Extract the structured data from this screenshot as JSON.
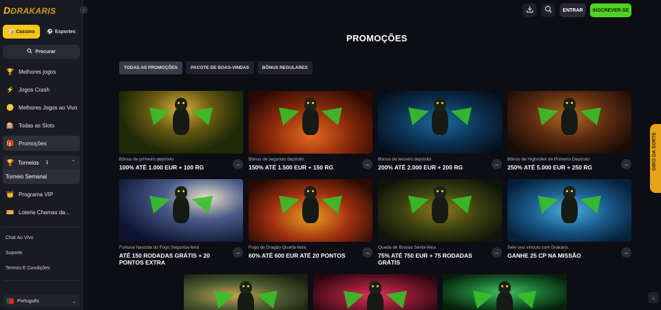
{
  "brand": {
    "logo_text": "DRAKARIS"
  },
  "sidebar": {
    "tabs": [
      {
        "label": "Cassino",
        "icon": "dice-icon",
        "active": true
      },
      {
        "label": "Esportes",
        "icon": "ball-icon",
        "active": false
      }
    ],
    "search_label": "Procurar",
    "items": [
      {
        "label": "Melhores jogos",
        "icon": "trophy-icon"
      },
      {
        "label": "Jogos Crash",
        "icon": "lightning-icon"
      },
      {
        "label": "Melhores Jogos ao Vivo",
        "icon": "chips-icon"
      },
      {
        "label": "Todas as Slots",
        "icon": "slot-icon"
      },
      {
        "label": "Promoções",
        "icon": "gift-icon",
        "active": true
      }
    ],
    "torneios": {
      "label": "Torneios",
      "count": "1",
      "sub_label": "Torneio Semanal"
    },
    "items2": [
      {
        "label": "Programa VIP",
        "icon": "crown-icon"
      },
      {
        "label": "Loteria Chamas da...",
        "icon": "ticket-icon"
      }
    ],
    "links": [
      "Chat Ao Vivo",
      "Suporte",
      "Termos E Condições"
    ],
    "language": "Português"
  },
  "header": {
    "entrar_label": "ENTRAR",
    "inscrever_label": "INSCREVER-SE"
  },
  "page": {
    "title": "PROMOÇÕES",
    "filters": [
      "TODAS AS PROMOÇÕES",
      "PACOTE DE BOAS-VINDAS",
      "BÔNUS REGULARES"
    ]
  },
  "promos": [
    {
      "subtitle": "Bônus de primeiro depósito",
      "title": "100% ATÉ 1.000 EUR + 100 RG"
    },
    {
      "subtitle": "Bônus de segundo depósito",
      "title": "150% ATÉ 1.500 EUR + 150 RG"
    },
    {
      "subtitle": "Bônus de terceiro depósito",
      "title": "200% ATÉ 2.000 EUR + 200 RG"
    },
    {
      "subtitle": "Bônus de Highroller de Primeiro Depósito",
      "title": "250% ATÉ 5.000 EUR + 250 RG"
    },
    {
      "subtitle": "Fortuna Nascida do Fogo Segunda-feira",
      "title": "ATÉ 150 RODADAS GRÁTIS + 20 PONTOS EXTRA"
    },
    {
      "subtitle": "Fogo de Dragão Quarta-feira",
      "title": "60% ATÉ 600 EUR ATÉ 20 PONTOS"
    },
    {
      "subtitle": "Queda de Brasas Sexta-feira",
      "title": "75% ATÉ 750 EUR + 75 RODADAS GRÁTIS"
    },
    {
      "subtitle": "Sele seu vínculo com Drakaris",
      "title": "GANHE 25 CP NA MISSÃO"
    }
  ],
  "side_tab_label": "GIRO DA SORTE"
}
